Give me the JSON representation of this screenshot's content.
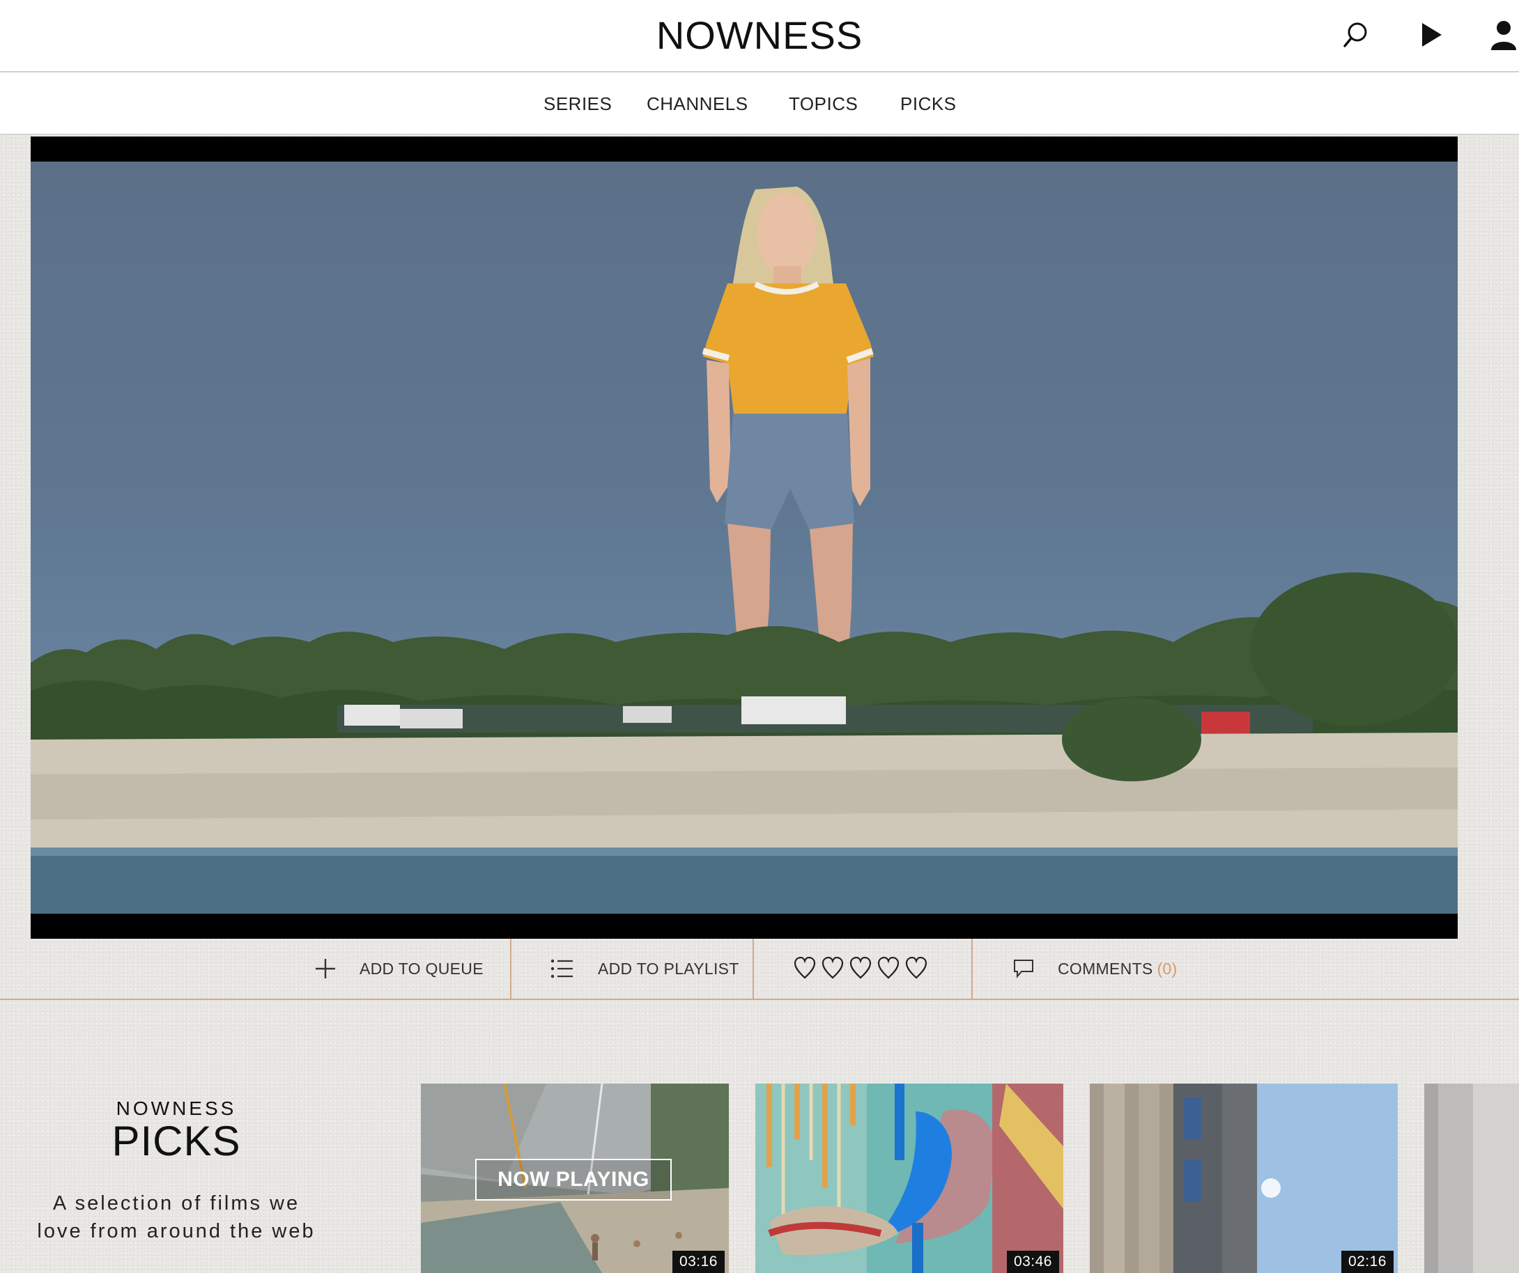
{
  "header": {
    "logo": "NOWNESS",
    "icons": [
      "search-icon",
      "play-icon",
      "user-icon"
    ]
  },
  "nav": {
    "items": [
      "SERIES",
      "CHANNELS",
      "TOPICS",
      "PICKS"
    ]
  },
  "actions": {
    "queue_label": "ADD TO QUEUE",
    "playlist_label": "ADD TO PLAYLIST",
    "comments_label": "COMMENTS",
    "comments_count": "(0)",
    "rating_max": 5
  },
  "picks": {
    "sup": "NOWNESS",
    "title": "PICKS",
    "description": "A selection of films we love from around the web",
    "now_playing_label": "NOW PLAYING",
    "cards": [
      {
        "duration": "03:16"
      },
      {
        "duration": "03:46"
      },
      {
        "duration": "02:16"
      },
      {
        "duration": ""
      }
    ]
  },
  "colors": {
    "accent": "#d59b6c",
    "divider": "#d2a98a"
  }
}
